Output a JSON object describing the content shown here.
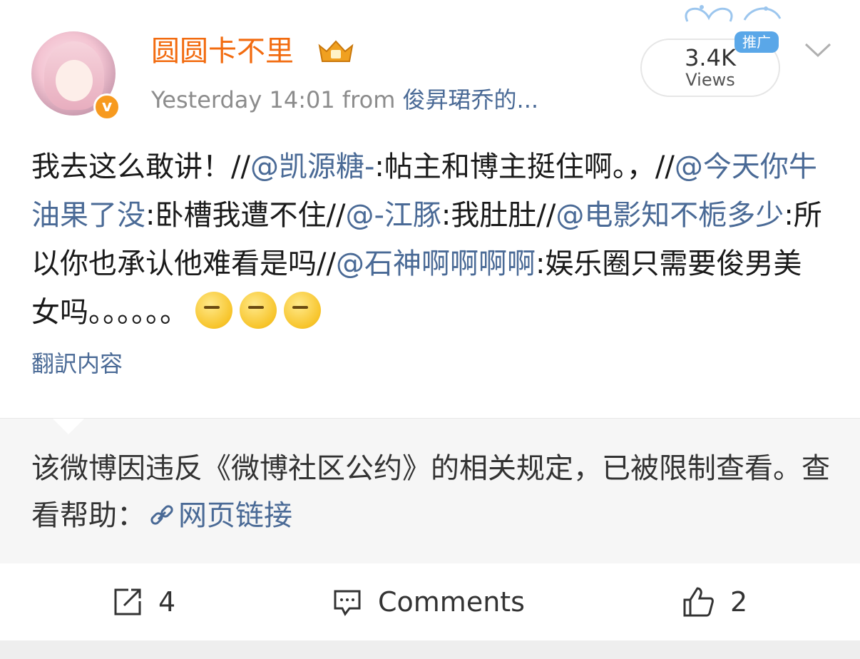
{
  "post": {
    "username": "圆圆卡不里",
    "time": "Yesterday 14:01",
    "from_label": "from",
    "source": "俊昇珺乔的...",
    "verified_badge": "v",
    "views_count": "3.4K",
    "views_label": "Views",
    "promo_label": "推广"
  },
  "content": {
    "t1": "我去这么敢讲！//",
    "m1": "@凯源糖-",
    "t2": ":帖主和博主挺住啊。，//",
    "m2": "@今天你牛油果了没",
    "t3": ":卧槽我遭不住//",
    "m3": "@-江豚",
    "t4": ":我肚肚//",
    "m4": "@电影知不栀多少",
    "t5": ":所以你也承认他难看是吗//",
    "m5": "@石神啊啊啊啊",
    "t6": ":娱乐圈只需要俊男美女吗。。。。。。",
    "emojis": [
      "smirk-emoji",
      "smirk-emoji",
      "smirk-emoji"
    ],
    "translate_label": "翻訳内容"
  },
  "notice": {
    "text": "该微博因违反《微博社区公约》的相关规定，已被限制查看。查看帮助：",
    "link_label": "网页链接"
  },
  "actions": {
    "repost_count": "4",
    "comments_label": "Comments",
    "likes_count": "2"
  },
  "icons": {
    "repost": "share-square-icon",
    "comment": "comment-bubble-icon",
    "like": "thumbs-up-icon",
    "link": "link-icon",
    "chevron": "chevron-down-icon",
    "crown": "crown-badge-icon"
  },
  "colors": {
    "username": "#f26b0f",
    "mention": "#4a6a96",
    "meta": "#8c8c8c",
    "promo": "#5aa7e8",
    "verified": "#f79a1f"
  }
}
